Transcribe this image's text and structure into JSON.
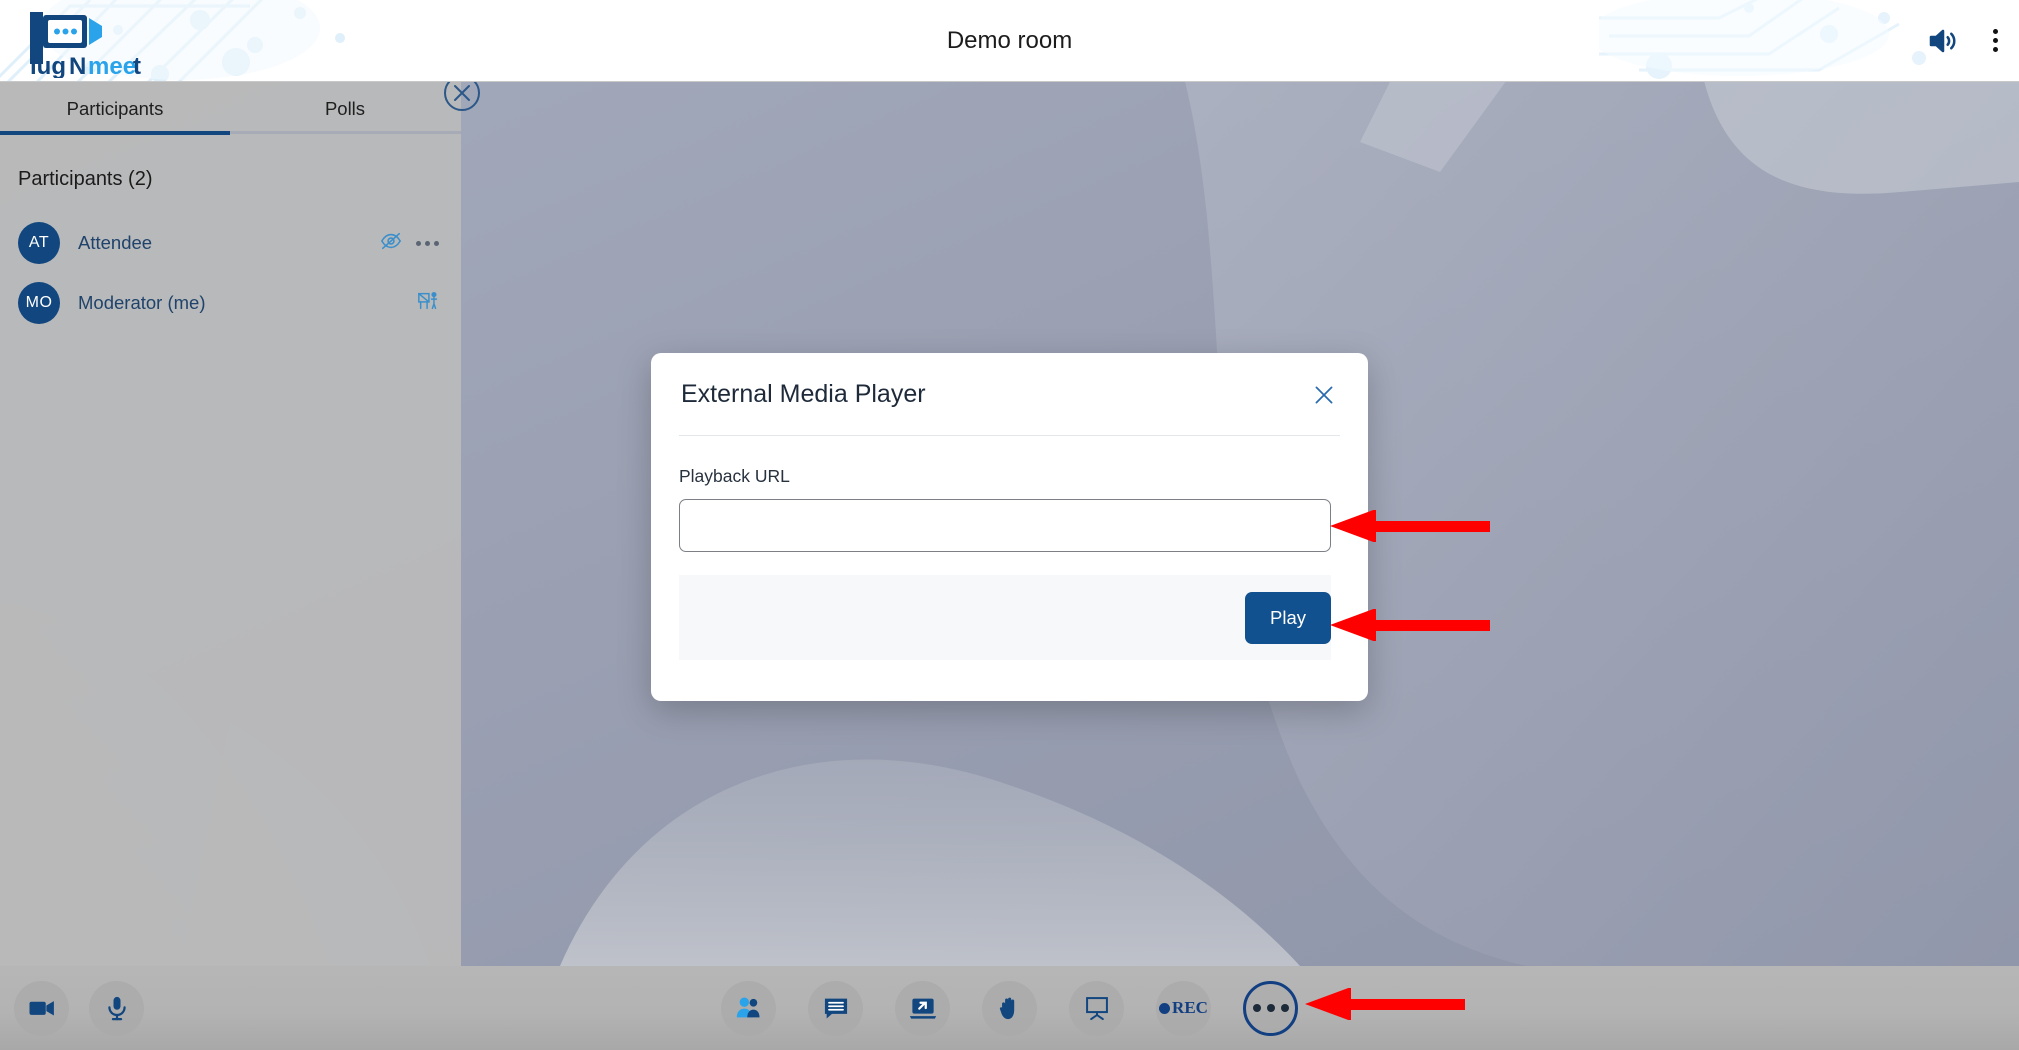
{
  "header": {
    "title": "Demo room",
    "logo_text_plug": "Plug",
    "logo_text_n": "N",
    "logo_text_meet": "meet",
    "speaker_icon": "speaker-volume-icon",
    "kebab_icon": "more-vertical-icon"
  },
  "sidebar": {
    "tabs": [
      {
        "label": "Participants",
        "active": true
      },
      {
        "label": "Polls",
        "active": false
      }
    ],
    "close_icon": "close-circle-icon",
    "participants_heading": "Participants (2)",
    "participants": [
      {
        "initials": "AT",
        "name": "Attendee",
        "icons": [
          "eye-off-icon",
          "more-horizontal-icon"
        ]
      },
      {
        "initials": "MO",
        "name": "Moderator (me)",
        "icons": [
          "presenter-icon"
        ]
      }
    ]
  },
  "modal": {
    "title": "External Media Player",
    "close_icon": "close-x-icon",
    "field_label": "Playback URL",
    "input_value": "",
    "input_placeholder": "",
    "play_label": "Play"
  },
  "bottom_bar": {
    "left_buttons": [
      {
        "name": "camera-icon",
        "label": "Camera"
      },
      {
        "name": "microphone-icon",
        "label": "Microphone"
      }
    ],
    "center_buttons": [
      {
        "name": "participants-icon",
        "label": "Participants"
      },
      {
        "name": "chat-icon",
        "label": "Chat"
      },
      {
        "name": "screen-share-icon",
        "label": "Share screen"
      },
      {
        "name": "raise-hand-icon",
        "label": "Raise hand"
      },
      {
        "name": "whiteboard-icon",
        "label": "Whiteboard"
      },
      {
        "name": "record-icon",
        "label": "REC"
      },
      {
        "name": "more-options-icon",
        "label": "More options"
      }
    ],
    "rec_label": "REC"
  },
  "annotations": [
    {
      "name": "arrow-to-url-input",
      "color": "#ff0000"
    },
    {
      "name": "arrow-to-play-button",
      "color": "#ff0000"
    },
    {
      "name": "arrow-to-more-options",
      "color": "#ff0000"
    }
  ],
  "colors": {
    "brand_dark_blue": "#11467f",
    "brand_light_blue": "#1c9ae8",
    "annotation_red": "#ff0000",
    "sidebar_bg": "#bababa",
    "bottom_bar_bg": "#b3b3b3"
  }
}
